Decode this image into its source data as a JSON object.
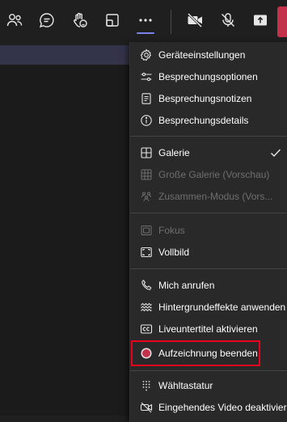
{
  "toolbar": {
    "buttons": [
      {
        "icon": "people-icon",
        "name": "participants-button"
      },
      {
        "icon": "chat-icon",
        "name": "chat-button"
      },
      {
        "icon": "raise-hand-icon",
        "name": "raise-hand-button"
      },
      {
        "icon": "rooms-icon",
        "name": "breakout-rooms-button"
      },
      {
        "icon": "more-actions-icon",
        "name": "more-actions-button"
      },
      {
        "icon": "camera-off-icon",
        "name": "camera-toggle-button"
      },
      {
        "icon": "mic-off-icon",
        "name": "mic-toggle-button"
      },
      {
        "icon": "share-icon",
        "name": "share-button"
      }
    ],
    "accent_color": "#7b83eb",
    "leave_color": "#c4314b"
  },
  "menu": {
    "items": [
      {
        "label": "Geräteeinstellungen",
        "icon": "gear-icon",
        "enabled": true
      },
      {
        "label": "Besprechungsoptionen",
        "icon": "sliders-icon",
        "enabled": true
      },
      {
        "label": "Besprechungsnotizen",
        "icon": "notes-icon",
        "enabled": true
      },
      {
        "label": "Besprechungsdetails",
        "icon": "info-icon",
        "enabled": true
      },
      {
        "label": "Galerie",
        "icon": "gallery-icon",
        "enabled": true,
        "checked": true
      },
      {
        "label": "Große Galerie (Vorschau)",
        "icon": "large-gallery-icon",
        "enabled": false
      },
      {
        "label": "Zusammen-Modus (Vors...",
        "icon": "together-mode-icon",
        "enabled": false
      },
      {
        "label": "Fokus",
        "icon": "focus-icon",
        "enabled": false
      },
      {
        "label": "Vollbild",
        "icon": "fullscreen-icon",
        "enabled": true
      },
      {
        "label": "Mich anrufen",
        "icon": "phone-icon",
        "enabled": true
      },
      {
        "label": "Hintergrundeffekte anwenden",
        "icon": "background-effects-icon",
        "enabled": true
      },
      {
        "label": "Liveuntertitel aktivieren",
        "icon": "captions-icon",
        "enabled": true
      },
      {
        "label": "Aufzeichnung beenden",
        "icon": "record-icon",
        "enabled": true
      },
      {
        "label": "Wähltastatur",
        "icon": "dialpad-icon",
        "enabled": true
      },
      {
        "label": "Eingehendes Video deaktivieren",
        "icon": "video-off-icon",
        "enabled": true
      }
    ],
    "highlight_color": "#e8001c",
    "record_color": "#c4314b"
  }
}
